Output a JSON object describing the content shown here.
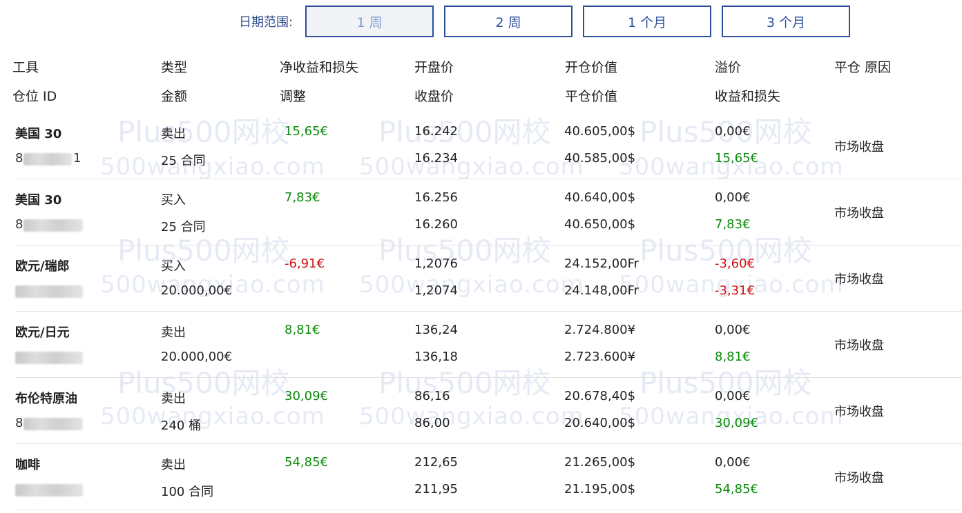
{
  "filter": {
    "label": "日期范围:",
    "options": [
      "1 周",
      "2 周",
      "1 个月",
      "3 个月"
    ],
    "selected": "1 周"
  },
  "headers": {
    "row1": [
      "工具",
      "类型",
      "净收益和损失",
      "开盘价",
      "开仓价值",
      "溢价",
      "平仓 原因"
    ],
    "row2": [
      "仓位 ID",
      "金额",
      "调整",
      "收盘价",
      "平仓价值",
      "收益和损失"
    ]
  },
  "watermark": {
    "brand": "Plus500网校",
    "site": "500wangxiao.com"
  },
  "positions": [
    {
      "instrument": "美国 30",
      "id_visible_start": "8",
      "id_visible_end": "1",
      "type": "卖出",
      "amount": "25 合同",
      "net_pnl": "15,65€",
      "net_sign": "pos",
      "open_price": "16.242",
      "close_price": "16.234",
      "open_value": "40.605,00$",
      "close_value": "40.585,00$",
      "premium": "0,00€",
      "pnl": "15,65€",
      "pnl_sign": "pos",
      "reason": "市场收盘"
    },
    {
      "instrument": "美国 30",
      "id_visible_start": "8",
      "id_visible_end": "",
      "type": "买入",
      "amount": "25 合同",
      "net_pnl": "7,83€",
      "net_sign": "pos",
      "open_price": "16.256",
      "close_price": "16.260",
      "open_value": "40.640,00$",
      "close_value": "40.650,00$",
      "premium": "0,00€",
      "pnl": "7,83€",
      "pnl_sign": "pos",
      "reason": "市场收盘"
    },
    {
      "instrument": "欧元/瑞郎",
      "id_visible_start": "",
      "id_visible_end": "",
      "type": "买入",
      "amount": "20.000,00€",
      "net_pnl": "-6,91€",
      "net_sign": "neg",
      "open_price": "1,2076",
      "close_price": "1,2074",
      "open_value": "24.152,00Fr",
      "close_value": "24.148,00Fr",
      "premium": "-3,60€",
      "premium_sign": "neg",
      "pnl": "-3,31€",
      "pnl_sign": "neg",
      "reason": "市场收盘"
    },
    {
      "instrument": "欧元/日元",
      "id_visible_start": "",
      "id_visible_end": "",
      "type": "卖出",
      "amount": "20.000,00€",
      "net_pnl": "8,81€",
      "net_sign": "pos",
      "open_price": "136,24",
      "close_price": "136,18",
      "open_value": "2.724.800¥",
      "close_value": "2.723.600¥",
      "premium": "0,00€",
      "pnl": "8,81€",
      "pnl_sign": "pos",
      "reason": "市场收盘"
    },
    {
      "instrument": "布伦特原油",
      "id_visible_start": "8",
      "id_visible_end": "",
      "type": "卖出",
      "amount": "240 桶",
      "net_pnl": "30,09€",
      "net_sign": "pos",
      "open_price": "86,16",
      "close_price": "86,00",
      "open_value": "20.678,40$",
      "close_value": "20.640,00$",
      "premium": "0,00€",
      "pnl": "30,09€",
      "pnl_sign": "pos",
      "reason": "市场收盘"
    },
    {
      "instrument": "咖啡",
      "id_visible_start": "",
      "id_visible_end": "",
      "type": "卖出",
      "amount": "100 合同",
      "net_pnl": "54,85€",
      "net_sign": "pos",
      "open_price": "212,65",
      "close_price": "211,95",
      "open_value": "21.265,00$",
      "close_value": "21.195,00$",
      "premium": "0,00€",
      "pnl": "54,85€",
      "pnl_sign": "pos",
      "reason": "市场收盘"
    }
  ],
  "colors": {
    "accent": "#2c4f9c",
    "positive": "#0a8a0a",
    "negative": "#d01010"
  }
}
